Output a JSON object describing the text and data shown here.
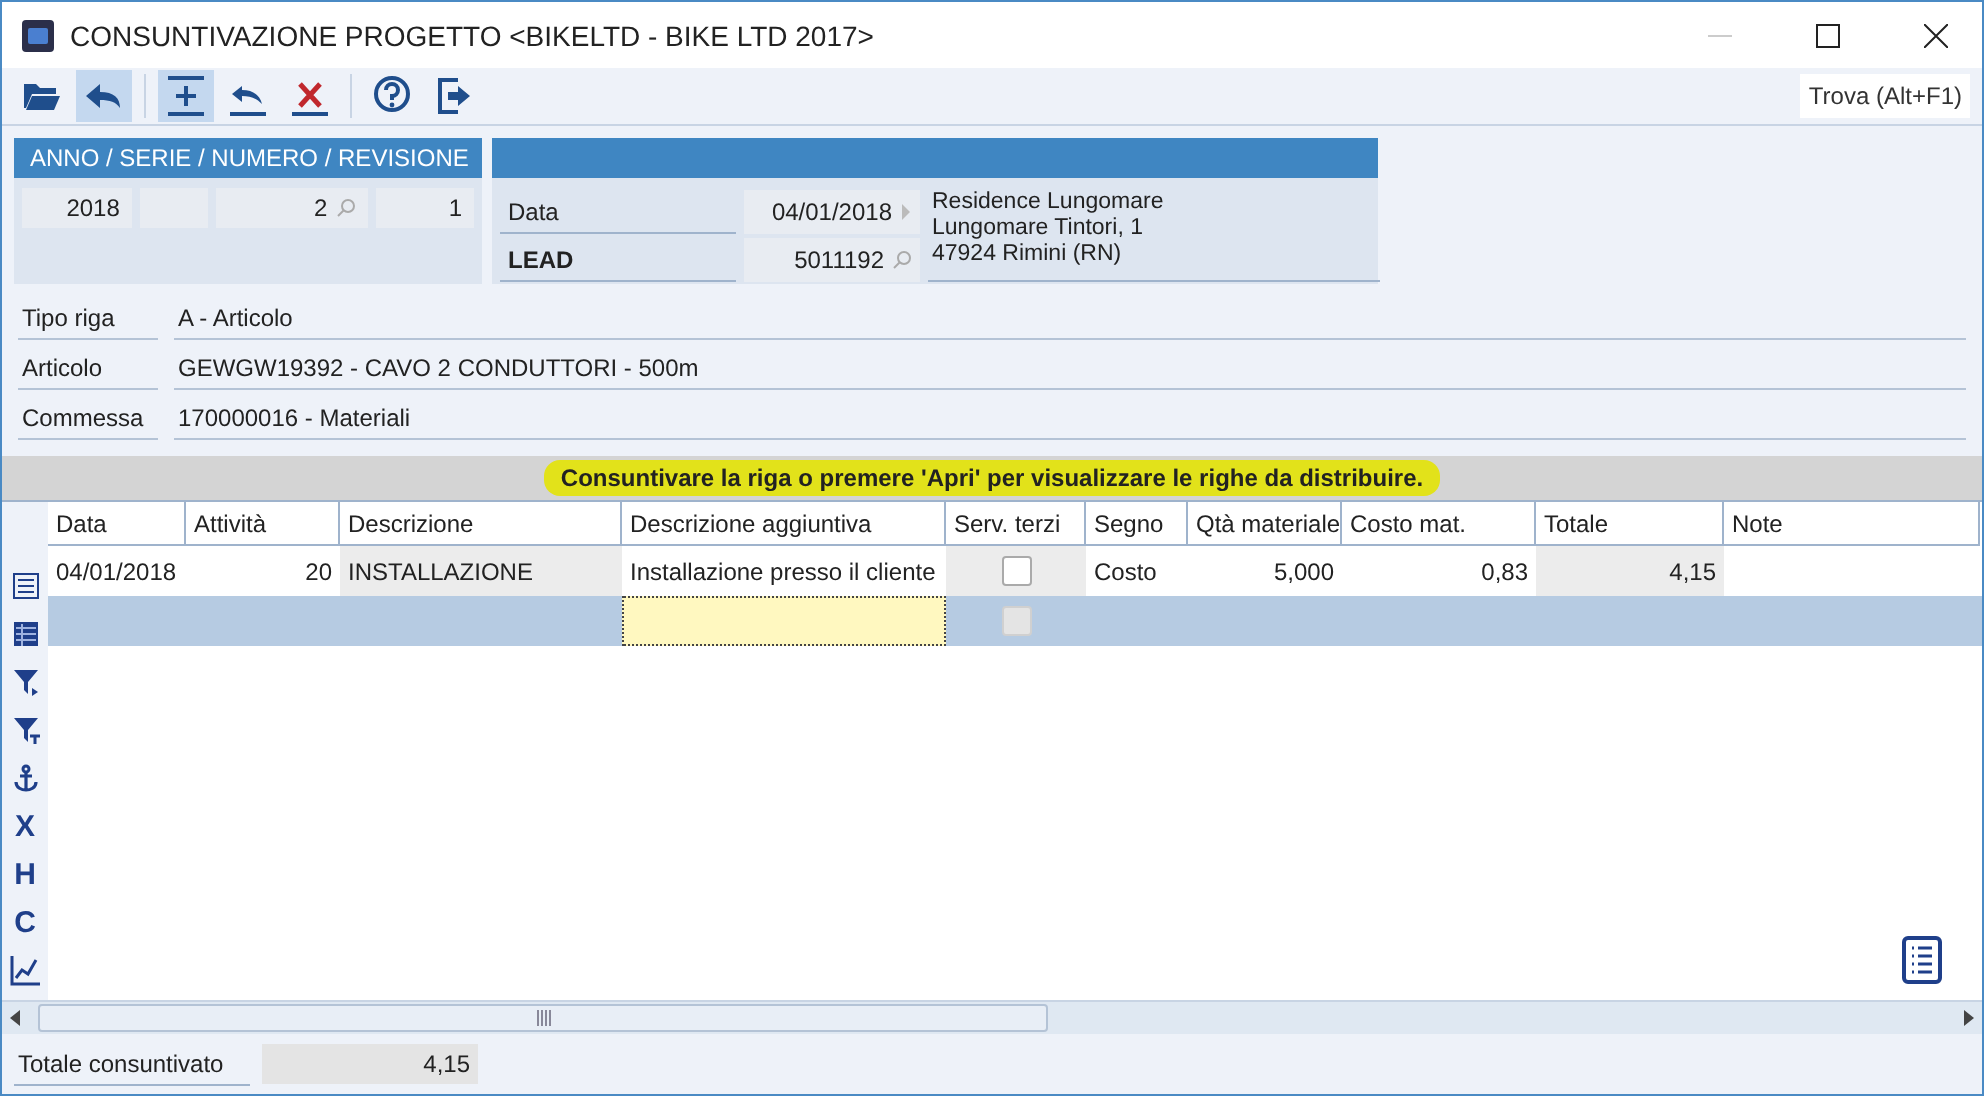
{
  "window": {
    "title": "CONSUNTIVAZIONE PROGETTO <BIKELTD - BIKE LTD 2017>"
  },
  "toolbar": [
    {
      "kind": "folder",
      "active": false
    },
    {
      "kind": "undo",
      "active": true
    },
    {
      "kind": "add",
      "active": true
    },
    {
      "kind": "revert",
      "active": false
    },
    {
      "kind": "delete",
      "active": false
    },
    {
      "kind": "help",
      "active": false
    },
    {
      "kind": "exit",
      "active": false
    }
  ],
  "find_button": "Trova (Alt+F1)",
  "document": {
    "header": "ANNO / SERIE / NUMERO / REVISIONE",
    "fields": [
      {
        "kind": "plain",
        "value": "2018"
      },
      {
        "kind": "blank"
      },
      {
        "kind": "lookup",
        "value": "2"
      },
      {
        "kind": "plain",
        "value": "1"
      }
    ]
  },
  "customer": {
    "rows": [
      {
        "kind": "date",
        "label": "Data",
        "value": "04/01/2018",
        "bold": false
      },
      {
        "kind": "lookup",
        "label": "LEAD",
        "value": "5011192",
        "bold": true
      }
    ],
    "address": [
      "Residence Lungomare",
      "Lungomare Tintori, 1",
      "47924 Rimini (RN)"
    ]
  },
  "fields": [
    {
      "label": "Tipo riga",
      "value": "A - Articolo"
    },
    {
      "label": "Articolo",
      "value": "GEWGW19392 - CAVO 2 CONDUTTORI - 500m"
    },
    {
      "label": "Commessa",
      "value": "170000016 - Materiali"
    }
  ],
  "banner": "Consuntivare la riga o premere 'Apri' per visualizzare le righe da distribuire.",
  "side_tools": [
    {
      "kind": "list"
    },
    {
      "kind": "grid"
    },
    {
      "kind": "filter"
    },
    {
      "kind": "filter-clear"
    },
    {
      "kind": "anchor"
    },
    {
      "kind": "letter",
      "label": "X"
    },
    {
      "kind": "letter",
      "label": "H"
    },
    {
      "kind": "letter",
      "label": "C"
    },
    {
      "kind": "chart"
    }
  ],
  "table": {
    "columns": [
      {
        "label": "Data",
        "kind": "text",
        "readonly": false
      },
      {
        "label": "Attività",
        "kind": "number",
        "readonly": false
      },
      {
        "label": "Descrizione",
        "kind": "text",
        "readonly": true
      },
      {
        "label": "Descrizione aggiuntiva",
        "kind": "text",
        "readonly": false
      },
      {
        "label": "Serv. terzi",
        "kind": "check",
        "readonly": true
      },
      {
        "label": "Segno",
        "kind": "text",
        "readonly": false
      },
      {
        "label": "Qtà materiale",
        "kind": "number",
        "readonly": false
      },
      {
        "label": "Costo mat.",
        "kind": "number",
        "readonly": false
      },
      {
        "label": "Totale",
        "kind": "number",
        "readonly": true
      },
      {
        "label": "Note",
        "kind": "text"
      }
    ],
    "rows": [
      {
        "selected": false,
        "cells": [
          {
            "text": "04/01/2018"
          },
          {
            "text": "20"
          },
          {
            "text": "INSTALLAZIONE"
          },
          {
            "text": "Installazione presso il cliente"
          },
          {
            "checked": false,
            "disabled": false
          },
          {
            "text": "Costo"
          },
          {
            "text": "5,000"
          },
          {
            "text": "0,83"
          },
          {
            "text": "4,15"
          },
          {}
        ]
      },
      {
        "selected": true,
        "cells": [
          {},
          {},
          {},
          {
            "focused": true
          },
          {
            "checked": false,
            "disabled": true
          },
          {},
          {},
          {},
          {},
          {}
        ]
      }
    ]
  },
  "footer": {
    "label": "Totale consuntivato",
    "value": "4,15"
  }
}
